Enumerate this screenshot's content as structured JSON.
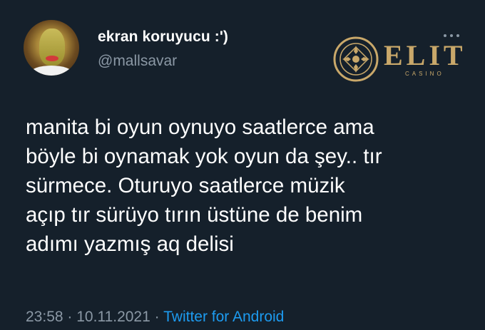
{
  "author": {
    "display_name": "ekran koruyucu :')",
    "handle": "@mallsavar",
    "avatar_icon": "profile-avatar"
  },
  "more_icon": "more-dots-icon",
  "watermark": {
    "logo_text": "ELIT",
    "logo_sub": "CASINO",
    "brand_color": "#c9a86a"
  },
  "tweet": {
    "lines": [
      "manita bi oyun oynuyo saatlerce ama",
      "böyle bi oynamak yok oyun da şey.. tır",
      "sürmece. Oturuyo saatlerce müzik",
      "açıp tır sürüyo tırın üstüne de benim",
      "adımı yazmış aq delisi"
    ]
  },
  "meta": {
    "time": "23:58",
    "separator": "·",
    "date": "10.11.2021",
    "source": "Twitter for Android"
  },
  "colors": {
    "background": "#15202b",
    "secondary_text": "#8b98a5",
    "link": "#1d9bf0"
  }
}
